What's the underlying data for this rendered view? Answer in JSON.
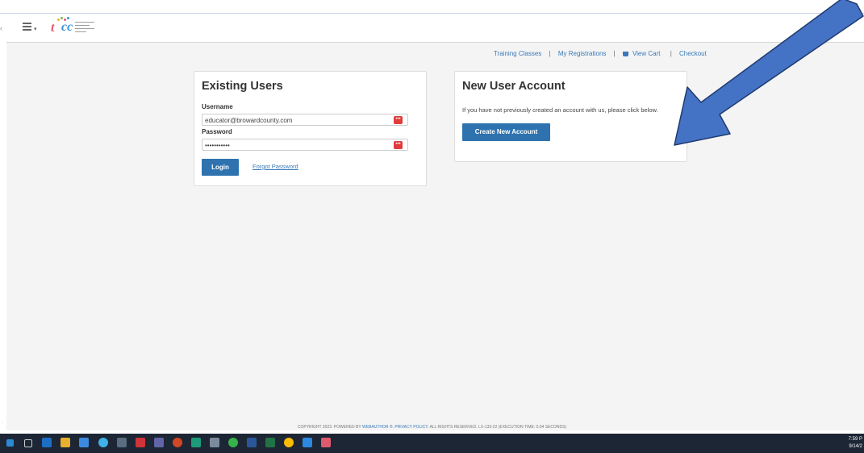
{
  "header": {
    "menu_icon": "hamburger-menu-icon",
    "logo_icon": "tcc-logo"
  },
  "topnav": {
    "items": [
      "Training Classes",
      "My Registrations",
      "View Cart",
      "Checkout"
    ],
    "separator": "|"
  },
  "existing_users": {
    "title": "Existing Users",
    "username_label": "Username",
    "username_value": "educator@browardcounty.com",
    "password_label": "Password",
    "password_value": "•••••••••••",
    "login_label": "Login",
    "forgot_label": "Forgot Password"
  },
  "new_user": {
    "title": "New User Account",
    "text": "If you have not previously created an account with us, please click below.",
    "create_label": "Create New Account"
  },
  "footer": {
    "text_a": "COPYRIGHT 2023. POWERED BY ",
    "link_a": "WEBAUTHOR ®",
    "text_b": ". ",
    "link_b": "PRIVACY POLICY",
    "text_c": ". ALL RIGHTS RESERVED. LX-133-22 (EXECUTION TIME: 0.04 SECONDS)"
  },
  "taskbar": {
    "time": "7:59 P",
    "date": "9/14/2"
  },
  "colors": {
    "accent": "#2e73b0",
    "arrow": "#4472c4",
    "pwd_icon": "#e03c3c"
  }
}
